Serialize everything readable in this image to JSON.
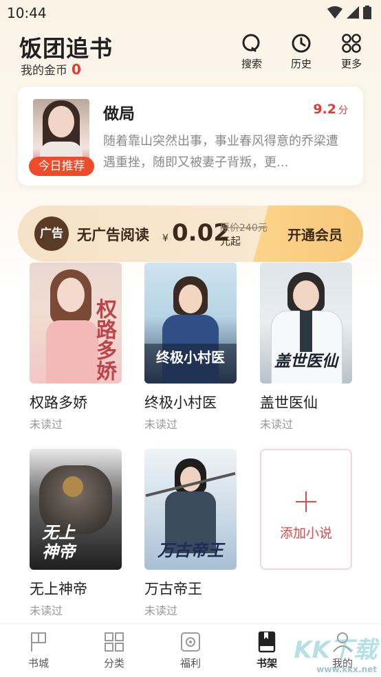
{
  "status_bar": {
    "time": "10:44"
  },
  "header": {
    "title": "饭团追书",
    "coins_label": "我的金币",
    "coins_value": "0",
    "search_label": "搜索",
    "history_label": "历史",
    "more_label": "更多"
  },
  "recommendation": {
    "badge": "今日推荐",
    "cover_text": "做局",
    "title": "做局",
    "score": "9.2",
    "score_unit": "分",
    "description": "随着靠山突然出事，事业春风得意的乔梁遭遇重挫，随即又被妻子背叛，更..."
  },
  "vip_banner": {
    "ad_icon_text": "广告",
    "text": "无广告阅读",
    "currency": "¥",
    "price": "0.02",
    "original_price": "原价240元",
    "unit": "元起",
    "cta": "开通会员"
  },
  "books": [
    {
      "title": "权路多娇",
      "status": "未读过",
      "cover_text": "权路多娇"
    },
    {
      "title": "终极小村医",
      "status": "未读过",
      "cover_text": "终极小村医"
    },
    {
      "title": "盖世医仙",
      "status": "未读过",
      "cover_text": "盖世医仙"
    },
    {
      "title": "无上神帝",
      "status": "未读过",
      "cover_text": "无上神帝"
    },
    {
      "title": "万古帝王",
      "status": "未读过",
      "cover_text": "万古帝王"
    }
  ],
  "add_novel": {
    "label": "添加小说"
  },
  "tabs": [
    {
      "label": "书城"
    },
    {
      "label": "分类"
    },
    {
      "label": "福利"
    },
    {
      "label": "书架"
    },
    {
      "label": "我的"
    }
  ],
  "watermark": {
    "text": "KK下载",
    "url": "www.kkx.net"
  },
  "colors": {
    "accent": "#e53a2f",
    "badge": "#ee4b2b",
    "vip_gold": "#f7c779"
  }
}
